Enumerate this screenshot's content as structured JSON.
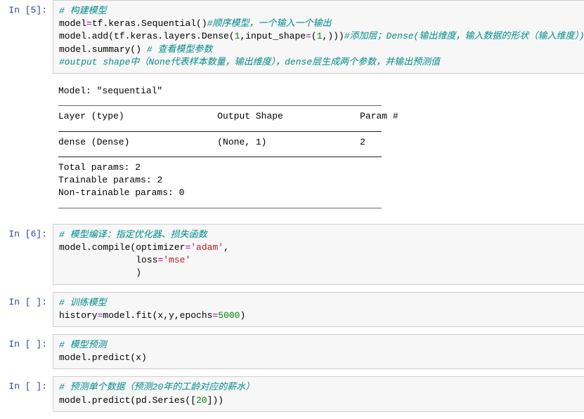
{
  "cells": {
    "c5": {
      "prompt": "In  [5]:",
      "line1_comment": "# 构建模型",
      "line2_a": "model",
      "line2_b": "tf.keras.Sequential()",
      "line2_comment": "#顺序模型，一个输入一个输出",
      "line3_a": "model.add(tf.keras.layers.Dense(",
      "line3_num1": "1",
      "line3_b": ",input_shape",
      "line3_c": "(",
      "line3_num2": "1",
      "line3_d": ",)))",
      "line3_comment": "#添加层；Dense(输出维度，输入数据的形状（输入维度）)",
      "line4_a": "model.summary() ",
      "line4_comment": "# 查看模型参数",
      "line5_comment": "#output shape中（None代表样本数量，输出维度），dense层生成两个参数，并输出预测值"
    },
    "c5_out": {
      "model_line": "Model: \"sequential\"",
      "header": "Layer (type)                 Output Shape              Param #   ",
      "row": "dense (Dense)                (None, 1)                 2         ",
      "total": "Total params: 2",
      "trainable": "Trainable params: 2",
      "nontrainable": "Non-trainable params: 0"
    },
    "c6": {
      "prompt": "In  [6]:",
      "line1_comment": "# 模型编译：指定优化器、损失函数",
      "line2_a": "model.compile(optimizer",
      "line2_str": "'adam'",
      "line3_a": "              loss",
      "line3_str": "'mse'",
      "line4": "              )"
    },
    "c7": {
      "prompt": "In  [ ]:",
      "line1_comment": "# 训练模型",
      "line2_a": "history",
      "line2_b": "model.fit(x,y,epochs",
      "line2_num": "5000",
      "line2_c": ")"
    },
    "c8": {
      "prompt": "In  [ ]:",
      "line1_comment": "# 模型预测",
      "line2": "model.predict(x)"
    },
    "c9": {
      "prompt": "In  [ ]:",
      "line1_comment": "# 预测单个数据（预测20年的工龄对应的薪水）",
      "line2_a": "model.predict(pd.Series([",
      "line2_num": "20",
      "line2_b": "]))"
    }
  }
}
